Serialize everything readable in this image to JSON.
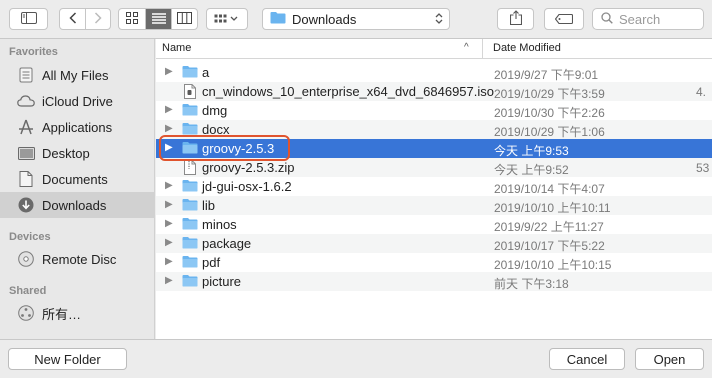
{
  "toolbar": {
    "location": "Downloads",
    "search_placeholder": "Search"
  },
  "sidebar": {
    "favorites_header": "Favorites",
    "devices_header": "Devices",
    "shared_header": "Shared",
    "favorites": [
      {
        "label": "All My Files",
        "icon": "all-files-icon"
      },
      {
        "label": "iCloud Drive",
        "icon": "cloud-icon"
      },
      {
        "label": "Applications",
        "icon": "applications-icon"
      },
      {
        "label": "Desktop",
        "icon": "desktop-icon"
      },
      {
        "label": "Documents",
        "icon": "documents-icon"
      },
      {
        "label": "Downloads",
        "icon": "download-icon",
        "selected": true
      }
    ],
    "devices": [
      {
        "label": "Remote Disc",
        "icon": "disc-icon"
      }
    ],
    "shared": [
      {
        "label": "所有…",
        "icon": "network-icon"
      }
    ]
  },
  "columns": {
    "name": "Name",
    "date": "Date Modified",
    "sort_indicator": "^"
  },
  "files": [
    {
      "name": "a",
      "date": "2019/9/27 下午9:01",
      "size": "",
      "kind": "folder",
      "expandable": true
    },
    {
      "name": "cn_windows_10_enterprise_x64_dvd_6846957.iso",
      "date": "2019/10/29 下午3:59",
      "size": "4.",
      "kind": "file",
      "expandable": false
    },
    {
      "name": "dmg",
      "date": "2019/10/30 下午2:26",
      "size": "",
      "kind": "folder",
      "expandable": true
    },
    {
      "name": "docx",
      "date": "2019/10/29 下午1:06",
      "size": "",
      "kind": "folder",
      "expandable": true
    },
    {
      "name": "groovy-2.5.3",
      "date": "今天 上午9:53",
      "size": "",
      "kind": "folder",
      "expandable": true,
      "selected": true
    },
    {
      "name": "groovy-2.5.3.zip",
      "date": "今天 上午9:52",
      "size": "53",
      "kind": "zip",
      "expandable": false
    },
    {
      "name": "jd-gui-osx-1.6.2",
      "date": "2019/10/14 下午4:07",
      "size": "",
      "kind": "folder",
      "expandable": true
    },
    {
      "name": "lib",
      "date": "2019/10/10 上午10:11",
      "size": "",
      "kind": "folder",
      "expandable": true
    },
    {
      "name": "minos",
      "date": "2019/9/22 上午11:27",
      "size": "",
      "kind": "folder",
      "expandable": true
    },
    {
      "name": "package",
      "date": "2019/10/17 下午5:22",
      "size": "",
      "kind": "folder",
      "expandable": true
    },
    {
      "name": "pdf",
      "date": "2019/10/10 上午10:15",
      "size": "",
      "kind": "folder",
      "expandable": true
    },
    {
      "name": "picture",
      "date": "前天 下午3:18",
      "size": "",
      "kind": "folder",
      "expandable": true
    }
  ],
  "footer": {
    "new_folder": "New Folder",
    "cancel": "Cancel",
    "open": "Open"
  },
  "colors": {
    "selection": "#3875d7",
    "folder": "#6ab4ef",
    "highlight_border": "#e0542e"
  }
}
